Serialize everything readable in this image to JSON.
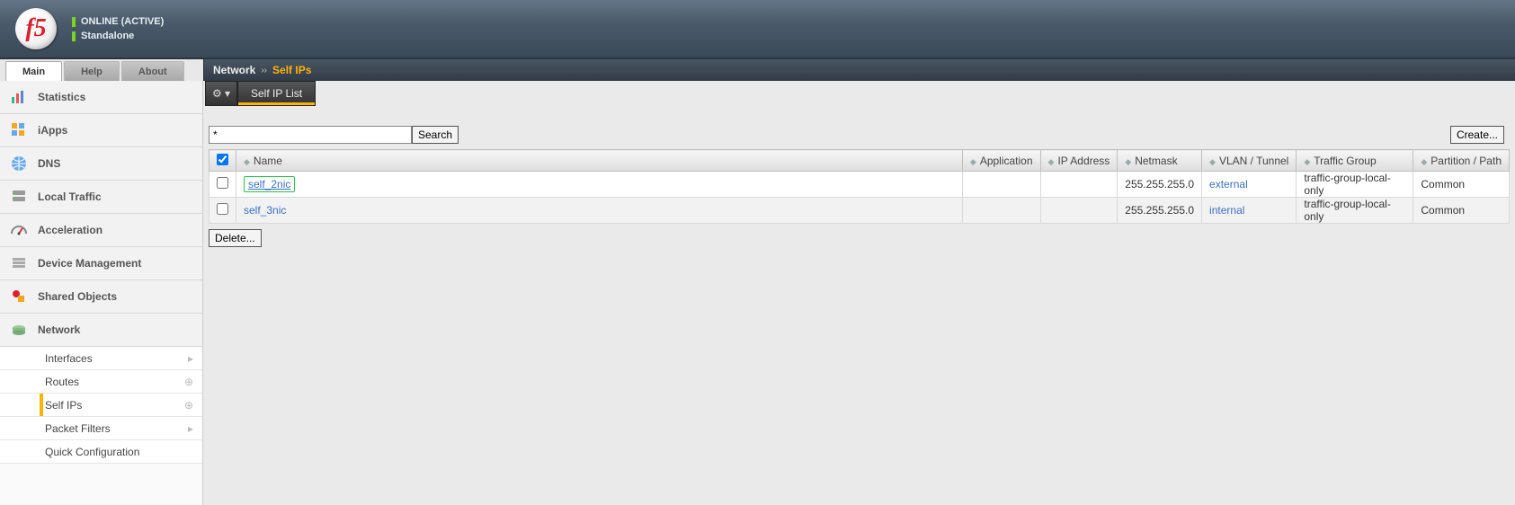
{
  "header": {
    "status_line1": "ONLINE (ACTIVE)",
    "status_line2": "Standalone",
    "logo_text": "f5"
  },
  "tabs": {
    "main": "Main",
    "help": "Help",
    "about": "About"
  },
  "breadcrumb": {
    "section": "Network",
    "page": "Self IPs"
  },
  "module_tab": {
    "gear_label": "⚙ ▾",
    "list_label": "Self IP List"
  },
  "sidebar": {
    "items": [
      {
        "label": "Statistics"
      },
      {
        "label": "iApps"
      },
      {
        "label": "DNS"
      },
      {
        "label": "Local Traffic"
      },
      {
        "label": "Acceleration"
      },
      {
        "label": "Device Management"
      },
      {
        "label": "Shared Objects"
      },
      {
        "label": "Network"
      }
    ],
    "network_children": [
      {
        "label": "Interfaces",
        "aux": "chevron"
      },
      {
        "label": "Routes",
        "aux": "plus"
      },
      {
        "label": "Self IPs",
        "aux": "plus",
        "selected": true
      },
      {
        "label": "Packet Filters",
        "aux": "chevron"
      },
      {
        "label": "Quick Configuration",
        "aux": ""
      }
    ]
  },
  "toolbar": {
    "search_value": "*",
    "search_button": "Search",
    "create_button": "Create..."
  },
  "table": {
    "columns": {
      "name": "Name",
      "application": "Application",
      "ip_address": "IP Address",
      "netmask": "Netmask",
      "vlan": "VLAN / Tunnel",
      "traffic_group": "Traffic Group",
      "partition": "Partition / Path"
    },
    "rows": [
      {
        "name": "self_2nic",
        "application": "",
        "ip_address": "",
        "netmask": "255.255.255.0",
        "vlan": "external",
        "traffic_group": "traffic-group-local-only",
        "partition": "Common",
        "highlight": true
      },
      {
        "name": "self_3nic",
        "application": "",
        "ip_address": "",
        "netmask": "255.255.255.0",
        "vlan": "internal",
        "traffic_group": "traffic-group-local-only",
        "partition": "Common",
        "highlight": false
      }
    ]
  },
  "actions": {
    "delete": "Delete..."
  }
}
